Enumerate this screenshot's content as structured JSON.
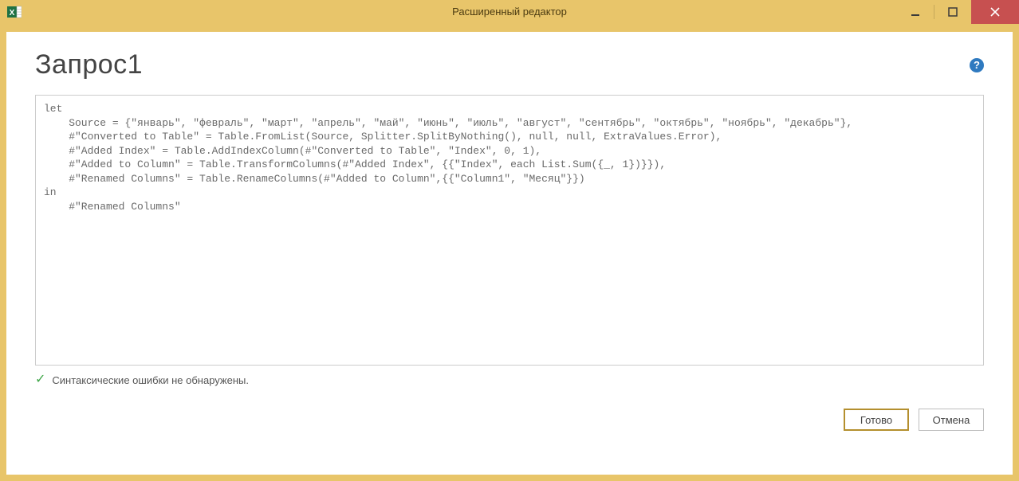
{
  "window": {
    "title": "Расширенный редактор"
  },
  "page": {
    "title": "Запрос1"
  },
  "code": "let\n    Source = {\"январь\", \"февраль\", \"март\", \"апрель\", \"май\", \"июнь\", \"июль\", \"август\", \"сентябрь\", \"октябрь\", \"ноябрь\", \"декабрь\"},\n    #\"Converted to Table\" = Table.FromList(Source, Splitter.SplitByNothing(), null, null, ExtraValues.Error),\n    #\"Added Index\" = Table.AddIndexColumn(#\"Converted to Table\", \"Index\", 0, 1),\n    #\"Added to Column\" = Table.TransformColumns(#\"Added Index\", {{\"Index\", each List.Sum({_, 1})}}),\n    #\"Renamed Columns\" = Table.RenameColumns(#\"Added to Column\",{{\"Column1\", \"Месяц\"}})\nin\n    #\"Renamed Columns\"",
  "status": {
    "message": "Синтаксические ошибки не обнаружены."
  },
  "buttons": {
    "done": "Готово",
    "cancel": "Отмена"
  },
  "help": {
    "glyph": "?"
  }
}
